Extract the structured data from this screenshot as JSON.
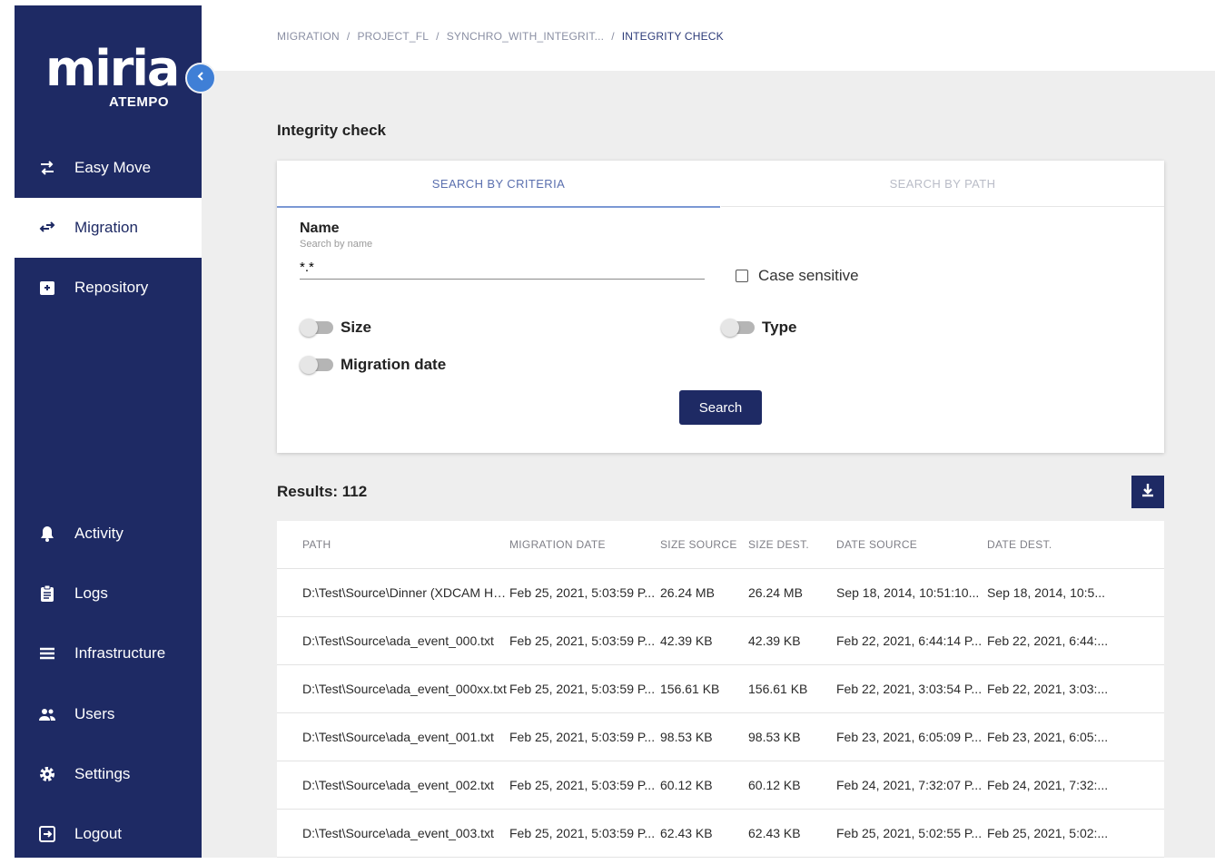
{
  "sidebar": {
    "logo_word": "miria",
    "logo_sub": "ATEMPO",
    "top_items": [
      {
        "label": "Easy Move",
        "icon": "swap-arrows-icon"
      },
      {
        "label": "Migration",
        "icon": "migration-arrows-icon",
        "active": true
      },
      {
        "label": "Repository",
        "icon": "archive-box-icon"
      }
    ],
    "bottom_items": [
      {
        "label": "Activity",
        "icon": "bell-icon"
      },
      {
        "label": "Logs",
        "icon": "clipboard-icon"
      },
      {
        "label": "Infrastructure",
        "icon": "list-icon"
      },
      {
        "label": "Users",
        "icon": "users-icon"
      },
      {
        "label": "Settings",
        "icon": "gear-icon"
      },
      {
        "label": "Logout",
        "icon": "logout-icon"
      }
    ]
  },
  "breadcrumb": {
    "items": [
      "MIGRATION",
      "PROJECT_FL",
      "SYNCHRO_WITH_INTEGRIT..."
    ],
    "separator": "/",
    "current": "INTEGRITY CHECK"
  },
  "page": {
    "title": "Integrity check",
    "tabs": {
      "criteria": "SEARCH BY CRITERIA",
      "path": "SEARCH BY PATH"
    },
    "name_label": "Name",
    "name_hint": "Search by name",
    "name_value": "*.*",
    "case_sensitive": "Case sensitive",
    "toggles": {
      "size": "Size",
      "type": "Type",
      "migration_date": "Migration date"
    },
    "search_button": "Search",
    "results": "Results: 112"
  },
  "table": {
    "headers": [
      "PATH",
      "MIGRATION DATE",
      "SIZE SOURCE",
      "SIZE DEST.",
      "DATE SOURCE",
      "DATE DEST."
    ],
    "rows": [
      [
        "D:\\Test\\Source\\Dinner (XDCAM HD...",
        "Feb 25, 2021, 5:03:59 P...",
        "26.24 MB",
        "26.24 MB",
        "Sep 18, 2014, 10:51:10...",
        "Sep 18, 2014, 10:5..."
      ],
      [
        "D:\\Test\\Source\\ada_event_000.txt",
        "Feb 25, 2021, 5:03:59 P...",
        "42.39 KB",
        "42.39 KB",
        "Feb 22, 2021, 6:44:14 P...",
        "Feb 22, 2021, 6:44:..."
      ],
      [
        "D:\\Test\\Source\\ada_event_000xx.txt",
        "Feb 25, 2021, 5:03:59 P...",
        "156.61 KB",
        "156.61 KB",
        "Feb 22, 2021, 3:03:54 P...",
        "Feb 22, 2021, 3:03:..."
      ],
      [
        "D:\\Test\\Source\\ada_event_001.txt",
        "Feb 25, 2021, 5:03:59 P...",
        "98.53 KB",
        "98.53 KB",
        "Feb 23, 2021, 6:05:09 P...",
        "Feb 23, 2021, 6:05:..."
      ],
      [
        "D:\\Test\\Source\\ada_event_002.txt",
        "Feb 25, 2021, 5:03:59 P...",
        "60.12 KB",
        "60.12 KB",
        "Feb 24, 2021, 7:32:07 P...",
        "Feb 24, 2021, 7:32:..."
      ],
      [
        "D:\\Test\\Source\\ada_event_003.txt",
        "Feb 25, 2021, 5:03:59 P...",
        "62.43 KB",
        "62.43 KB",
        "Feb 25, 2021, 5:02:55 P...",
        "Feb 25, 2021, 5:02:..."
      ]
    ]
  },
  "colors": {
    "sidebar_bg": "#1e2a64",
    "accent": "#3f7fd6",
    "page_bg": "#eeeeee"
  }
}
